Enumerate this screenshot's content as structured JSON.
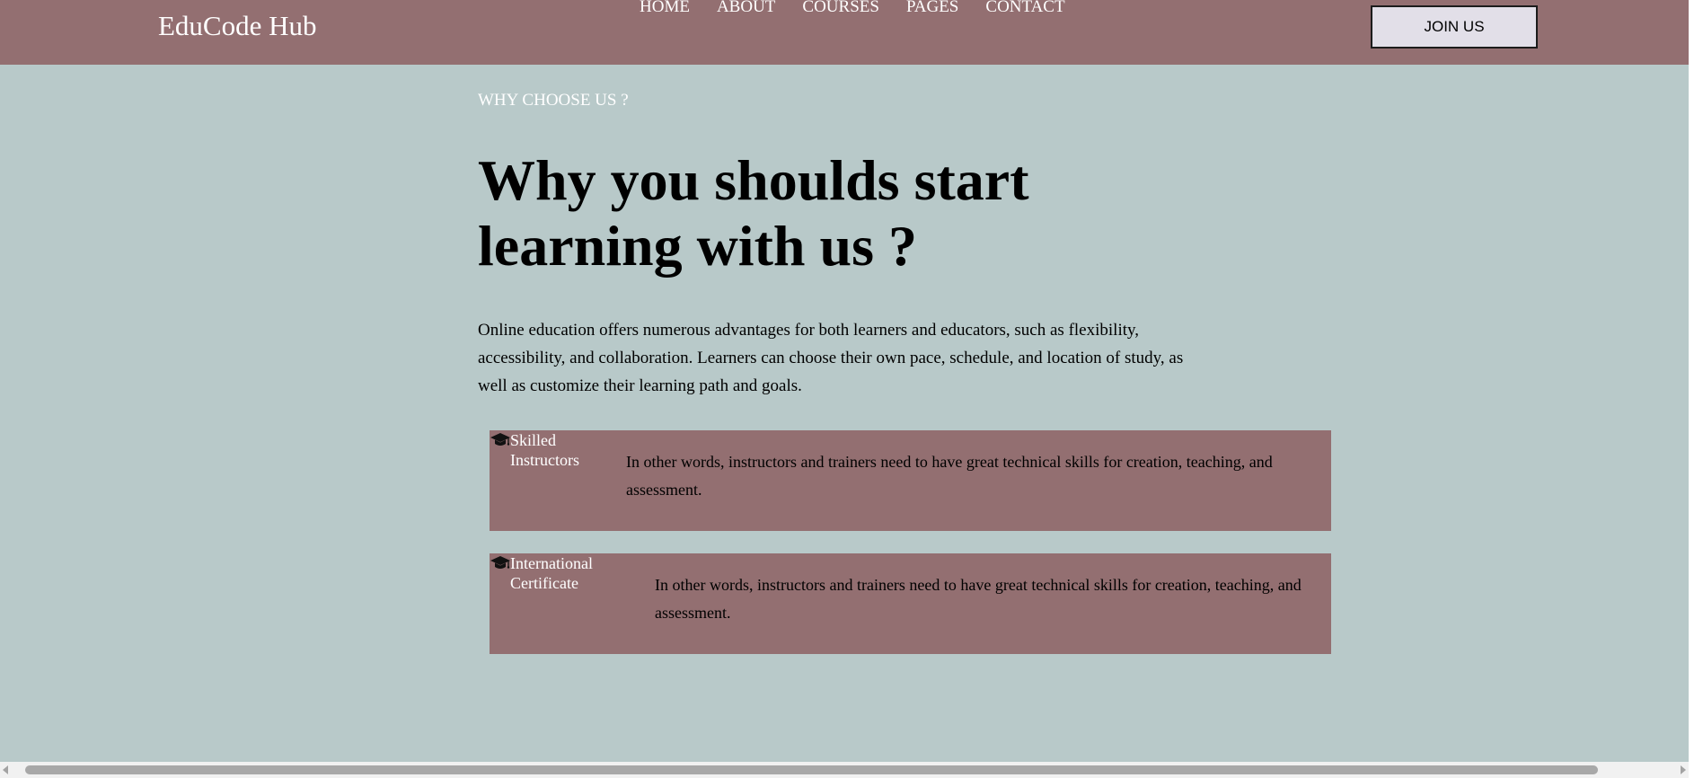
{
  "header": {
    "logo": "EduCode Hub",
    "nav": {
      "home": "HOME",
      "about": "ABOUT",
      "courses": "COURSES",
      "pages": "PAGES",
      "contact": "CONTACT"
    },
    "join_label": "JOIN US"
  },
  "section": {
    "eyebrow": "WHY CHOOSE US ?",
    "headline": "Why you shoulds start learning with us ?",
    "description": "Online education offers numerous advantages for both learners and educators, such as flexibility, accessibility, and collaboration. Learners can choose their own pace, schedule, and location of study, as well as customize their learning path and goals."
  },
  "features": [
    {
      "icon": "graduation-cap-icon",
      "title": "Skilled Instructors",
      "text": "In other words, instructors and trainers need to have great technical skills for creation, teaching, and assessment."
    },
    {
      "icon": "graduation-cap-icon",
      "title": "International Certificate",
      "text": "In other words, instructors and trainers need to have great technical skills for creation, teaching, and assessment."
    }
  ],
  "colors": {
    "page_background": "#b8c9c9",
    "header_background": "#936f71",
    "card_background": "#936f71",
    "button_background": "#e2dfe8"
  }
}
